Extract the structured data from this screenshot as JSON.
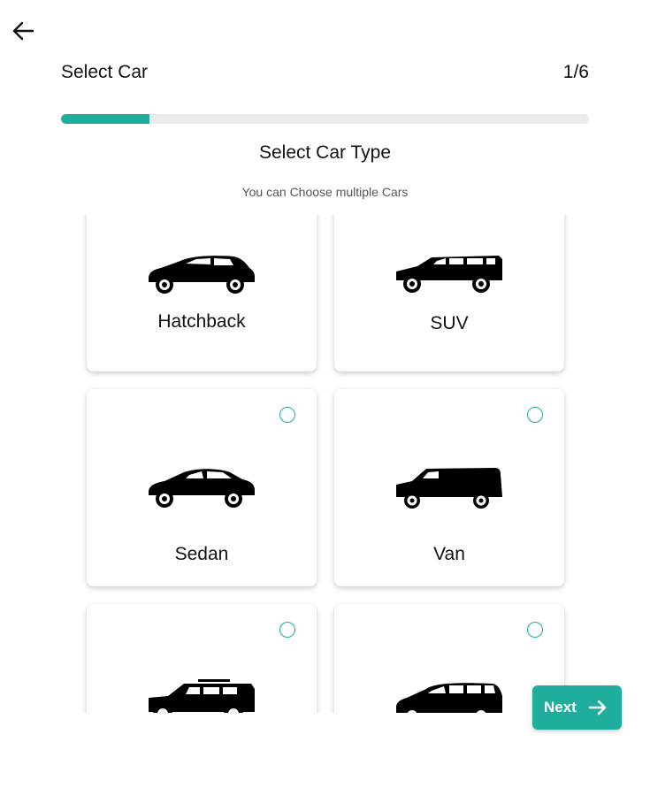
{
  "header": {
    "title": "Select Car",
    "step": "1/6",
    "progress": 0.1667
  },
  "section": {
    "title": "Select Car Type",
    "subtitle": "You can Choose multiple Cars"
  },
  "car_types": [
    {
      "label": "Hatchback",
      "icon": "hatchback-icon"
    },
    {
      "label": "SUV",
      "icon": "suv-icon"
    },
    {
      "label": "Sedan",
      "icon": "sedan-icon"
    },
    {
      "label": "Van",
      "icon": "van-icon"
    },
    {
      "label": "",
      "icon": "jeep-icon"
    },
    {
      "label": "",
      "icon": "minivan-icon"
    }
  ],
  "footer": {
    "next_label": "Next"
  },
  "colors": {
    "accent": "#1fad9d",
    "track": "#e9ebee"
  }
}
